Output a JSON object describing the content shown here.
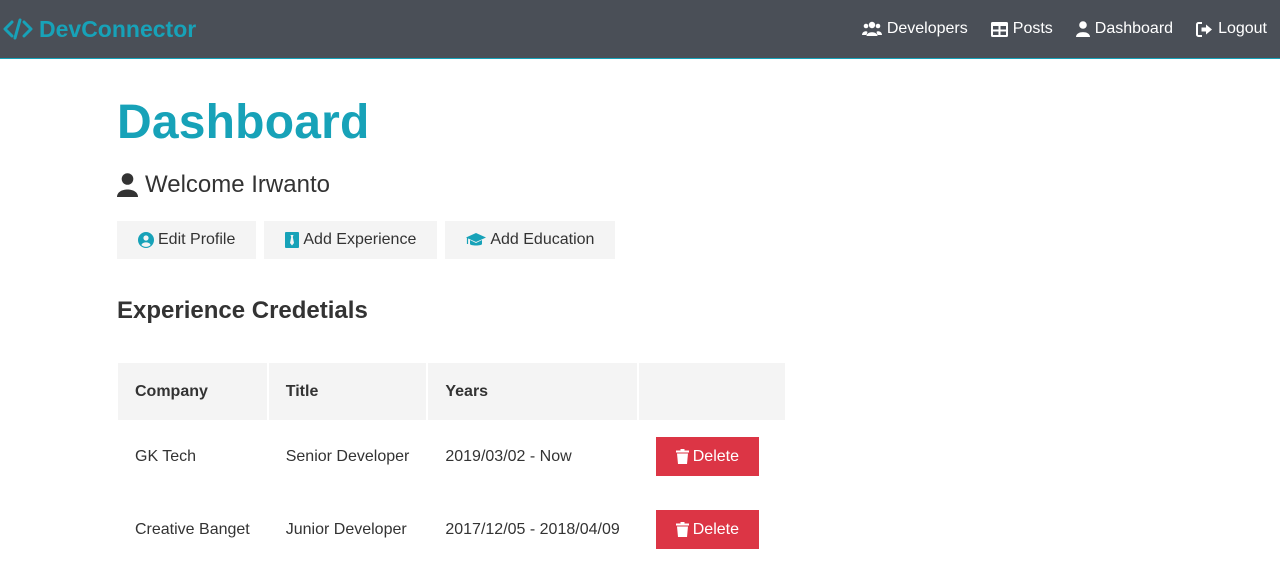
{
  "navbar": {
    "brand": "DevConnector",
    "links": [
      {
        "label": "Developers",
        "icon": "users-icon"
      },
      {
        "label": "Posts",
        "icon": "posts-icon"
      },
      {
        "label": "Dashboard",
        "icon": "user-icon"
      },
      {
        "label": "Logout",
        "icon": "logout-icon"
      }
    ]
  },
  "page": {
    "title": "Dashboard",
    "welcome": "Welcome Irwanto"
  },
  "actions": [
    {
      "label": "Edit Profile",
      "icon": "user-circle-icon"
    },
    {
      "label": "Add Experience",
      "icon": "black-tie-icon"
    },
    {
      "label": "Add Education",
      "icon": "graduation-cap-icon"
    }
  ],
  "experience": {
    "heading": "Experience Credetials",
    "columns": [
      "Company",
      "Title",
      "Years",
      ""
    ],
    "rows": [
      {
        "company": "GK Tech",
        "title": "Senior Developer",
        "years": "2019/03/02 - Now",
        "action": "Delete"
      },
      {
        "company": "Creative Banget",
        "title": "Junior Developer",
        "years": "2017/12/05 - 2018/04/09",
        "action": "Delete"
      }
    ]
  },
  "colors": {
    "primary": "#17a2b8",
    "navbar": "#4a4f57",
    "light": "#f4f4f4",
    "danger": "#dc3545"
  }
}
